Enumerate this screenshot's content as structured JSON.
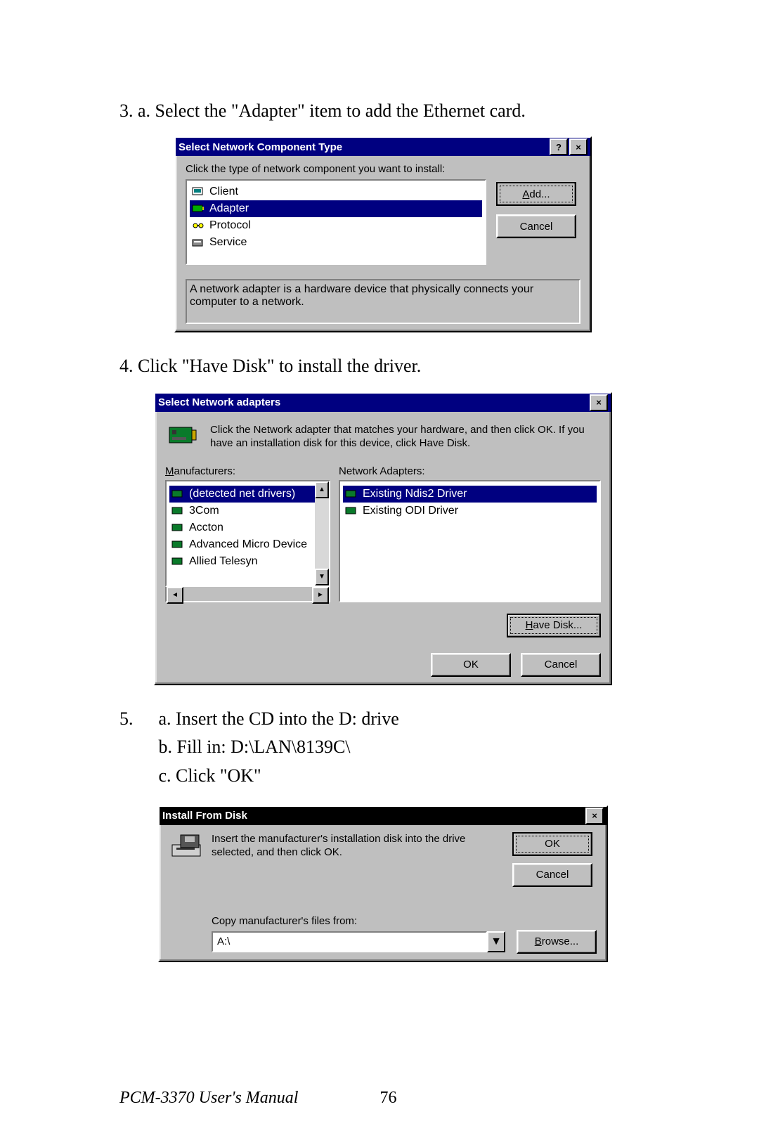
{
  "steps": {
    "s3": "3. a. Select the \"Adapter\" item to add the Ethernet card.",
    "s4": "4.  Click \"Have Disk\" to install the driver.",
    "s5": "5.",
    "s5a": "a. Insert the CD into the D: drive",
    "s5b": "b. Fill in: D:\\LAN\\8139C\\",
    "s5c": "c. Click \"OK\""
  },
  "dlg1": {
    "title": "Select Network Component Type",
    "prompt": "Click the type of network component you want to install:",
    "items": [
      "Client",
      "Adapter",
      "Protocol",
      "Service"
    ],
    "selected": 1,
    "add": "Add...",
    "cancel": "Cancel",
    "desc": "A network adapter is a hardware device that physically connects your computer to a network."
  },
  "dlg2": {
    "title": "Select Network adapters",
    "intro": "Click the Network adapter that matches your hardware, and then click OK. If you have an installation disk for this device, click Have Disk.",
    "man_label": "Manufacturers:",
    "ada_label": "Network Adapters:",
    "manufacturers": [
      "(detected net drivers)",
      "3Com",
      "Accton",
      "Advanced Micro Device",
      "Allied Telesyn"
    ],
    "man_sel": 0,
    "adapters": [
      "Existing Ndis2 Driver",
      "Existing ODI Driver"
    ],
    "have_disk": "Have Disk...",
    "ok": "OK",
    "cancel": "Cancel"
  },
  "dlg3": {
    "title": "Install From Disk",
    "msg": "Insert the manufacturer's installation disk into the drive selected, and then click OK.",
    "copy_label": "Copy manufacturer's files from:",
    "path": "A:\\",
    "ok": "OK",
    "cancel": "Cancel",
    "browse": "Browse..."
  },
  "footer": {
    "book": "PCM-3370 User's Manual",
    "page": "76"
  }
}
